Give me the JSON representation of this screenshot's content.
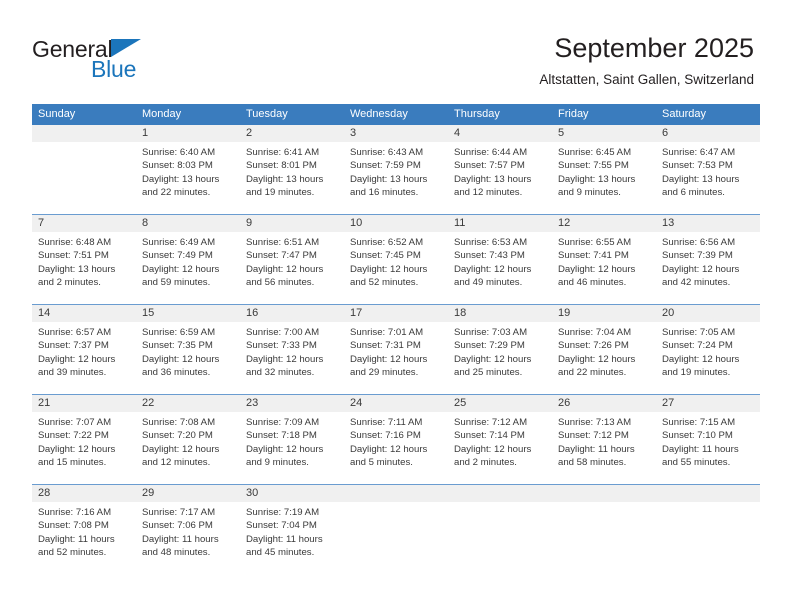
{
  "brand": {
    "name_part1": "General",
    "name_part2": "Blue"
  },
  "header": {
    "title": "September 2025",
    "subtitle": "Altstatten, Saint Gallen, Switzerland"
  },
  "weekdays": [
    "Sunday",
    "Monday",
    "Tuesday",
    "Wednesday",
    "Thursday",
    "Friday",
    "Saturday"
  ],
  "colors": {
    "header_blue": "#3a7cbe",
    "row_divider": "#6a9cd0",
    "date_band": "#f0f0f0",
    "brand_blue": "#1b75bb",
    "text": "#3a3a3a"
  },
  "weeks": [
    [
      {
        "date": "",
        "empty": true
      },
      {
        "date": "1",
        "sunrise": "Sunrise: 6:40 AM",
        "sunset": "Sunset: 8:03 PM",
        "daylight1": "Daylight: 13 hours",
        "daylight2": "and 22 minutes."
      },
      {
        "date": "2",
        "sunrise": "Sunrise: 6:41 AM",
        "sunset": "Sunset: 8:01 PM",
        "daylight1": "Daylight: 13 hours",
        "daylight2": "and 19 minutes."
      },
      {
        "date": "3",
        "sunrise": "Sunrise: 6:43 AM",
        "sunset": "Sunset: 7:59 PM",
        "daylight1": "Daylight: 13 hours",
        "daylight2": "and 16 minutes."
      },
      {
        "date": "4",
        "sunrise": "Sunrise: 6:44 AM",
        "sunset": "Sunset: 7:57 PM",
        "daylight1": "Daylight: 13 hours",
        "daylight2": "and 12 minutes."
      },
      {
        "date": "5",
        "sunrise": "Sunrise: 6:45 AM",
        "sunset": "Sunset: 7:55 PM",
        "daylight1": "Daylight: 13 hours",
        "daylight2": "and 9 minutes."
      },
      {
        "date": "6",
        "sunrise": "Sunrise: 6:47 AM",
        "sunset": "Sunset: 7:53 PM",
        "daylight1": "Daylight: 13 hours",
        "daylight2": "and 6 minutes."
      }
    ],
    [
      {
        "date": "7",
        "sunrise": "Sunrise: 6:48 AM",
        "sunset": "Sunset: 7:51 PM",
        "daylight1": "Daylight: 13 hours",
        "daylight2": "and 2 minutes."
      },
      {
        "date": "8",
        "sunrise": "Sunrise: 6:49 AM",
        "sunset": "Sunset: 7:49 PM",
        "daylight1": "Daylight: 12 hours",
        "daylight2": "and 59 minutes."
      },
      {
        "date": "9",
        "sunrise": "Sunrise: 6:51 AM",
        "sunset": "Sunset: 7:47 PM",
        "daylight1": "Daylight: 12 hours",
        "daylight2": "and 56 minutes."
      },
      {
        "date": "10",
        "sunrise": "Sunrise: 6:52 AM",
        "sunset": "Sunset: 7:45 PM",
        "daylight1": "Daylight: 12 hours",
        "daylight2": "and 52 minutes."
      },
      {
        "date": "11",
        "sunrise": "Sunrise: 6:53 AM",
        "sunset": "Sunset: 7:43 PM",
        "daylight1": "Daylight: 12 hours",
        "daylight2": "and 49 minutes."
      },
      {
        "date": "12",
        "sunrise": "Sunrise: 6:55 AM",
        "sunset": "Sunset: 7:41 PM",
        "daylight1": "Daylight: 12 hours",
        "daylight2": "and 46 minutes."
      },
      {
        "date": "13",
        "sunrise": "Sunrise: 6:56 AM",
        "sunset": "Sunset: 7:39 PM",
        "daylight1": "Daylight: 12 hours",
        "daylight2": "and 42 minutes."
      }
    ],
    [
      {
        "date": "14",
        "sunrise": "Sunrise: 6:57 AM",
        "sunset": "Sunset: 7:37 PM",
        "daylight1": "Daylight: 12 hours",
        "daylight2": "and 39 minutes."
      },
      {
        "date": "15",
        "sunrise": "Sunrise: 6:59 AM",
        "sunset": "Sunset: 7:35 PM",
        "daylight1": "Daylight: 12 hours",
        "daylight2": "and 36 minutes."
      },
      {
        "date": "16",
        "sunrise": "Sunrise: 7:00 AM",
        "sunset": "Sunset: 7:33 PM",
        "daylight1": "Daylight: 12 hours",
        "daylight2": "and 32 minutes."
      },
      {
        "date": "17",
        "sunrise": "Sunrise: 7:01 AM",
        "sunset": "Sunset: 7:31 PM",
        "daylight1": "Daylight: 12 hours",
        "daylight2": "and 29 minutes."
      },
      {
        "date": "18",
        "sunrise": "Sunrise: 7:03 AM",
        "sunset": "Sunset: 7:29 PM",
        "daylight1": "Daylight: 12 hours",
        "daylight2": "and 25 minutes."
      },
      {
        "date": "19",
        "sunrise": "Sunrise: 7:04 AM",
        "sunset": "Sunset: 7:26 PM",
        "daylight1": "Daylight: 12 hours",
        "daylight2": "and 22 minutes."
      },
      {
        "date": "20",
        "sunrise": "Sunrise: 7:05 AM",
        "sunset": "Sunset: 7:24 PM",
        "daylight1": "Daylight: 12 hours",
        "daylight2": "and 19 minutes."
      }
    ],
    [
      {
        "date": "21",
        "sunrise": "Sunrise: 7:07 AM",
        "sunset": "Sunset: 7:22 PM",
        "daylight1": "Daylight: 12 hours",
        "daylight2": "and 15 minutes."
      },
      {
        "date": "22",
        "sunrise": "Sunrise: 7:08 AM",
        "sunset": "Sunset: 7:20 PM",
        "daylight1": "Daylight: 12 hours",
        "daylight2": "and 12 minutes."
      },
      {
        "date": "23",
        "sunrise": "Sunrise: 7:09 AM",
        "sunset": "Sunset: 7:18 PM",
        "daylight1": "Daylight: 12 hours",
        "daylight2": "and 9 minutes."
      },
      {
        "date": "24",
        "sunrise": "Sunrise: 7:11 AM",
        "sunset": "Sunset: 7:16 PM",
        "daylight1": "Daylight: 12 hours",
        "daylight2": "and 5 minutes."
      },
      {
        "date": "25",
        "sunrise": "Sunrise: 7:12 AM",
        "sunset": "Sunset: 7:14 PM",
        "daylight1": "Daylight: 12 hours",
        "daylight2": "and 2 minutes."
      },
      {
        "date": "26",
        "sunrise": "Sunrise: 7:13 AM",
        "sunset": "Sunset: 7:12 PM",
        "daylight1": "Daylight: 11 hours",
        "daylight2": "and 58 minutes."
      },
      {
        "date": "27",
        "sunrise": "Sunrise: 7:15 AM",
        "sunset": "Sunset: 7:10 PM",
        "daylight1": "Daylight: 11 hours",
        "daylight2": "and 55 minutes."
      }
    ],
    [
      {
        "date": "28",
        "sunrise": "Sunrise: 7:16 AM",
        "sunset": "Sunset: 7:08 PM",
        "daylight1": "Daylight: 11 hours",
        "daylight2": "and 52 minutes."
      },
      {
        "date": "29",
        "sunrise": "Sunrise: 7:17 AM",
        "sunset": "Sunset: 7:06 PM",
        "daylight1": "Daylight: 11 hours",
        "daylight2": "and 48 minutes."
      },
      {
        "date": "30",
        "sunrise": "Sunrise: 7:19 AM",
        "sunset": "Sunset: 7:04 PM",
        "daylight1": "Daylight: 11 hours",
        "daylight2": "and 45 minutes."
      },
      {
        "date": "",
        "empty": true
      },
      {
        "date": "",
        "empty": true
      },
      {
        "date": "",
        "empty": true
      },
      {
        "date": "",
        "empty": true
      }
    ]
  ]
}
